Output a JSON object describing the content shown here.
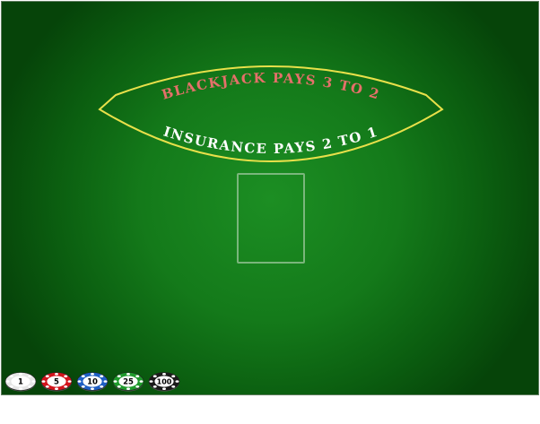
{
  "table": {
    "felt_color": "#147a1a",
    "arc_color": "#e8e04a",
    "payout_text": "BLACKJACK PAYS 3 TO 2",
    "payout_color": "#e5706a",
    "insurance_text": "INSURANCE PAYS 2 TO 1",
    "insurance_color": "#ffffff"
  },
  "chips": [
    {
      "label": "1",
      "color": "#e6e6e6",
      "text_color": "#000000",
      "icon": "chip-white-icon"
    },
    {
      "label": "5",
      "color": "#d2141c",
      "text_color": "#000000",
      "icon": "chip-red-icon"
    },
    {
      "label": "10",
      "color": "#1f5fc4",
      "text_color": "#000000",
      "icon": "chip-blue-icon"
    },
    {
      "label": "25",
      "color": "#1f9a2c",
      "text_color": "#000000",
      "icon": "chip-green-icon"
    },
    {
      "label": "100",
      "color": "#1a1a1a",
      "text_color": "#000000",
      "icon": "chip-black-icon"
    }
  ]
}
